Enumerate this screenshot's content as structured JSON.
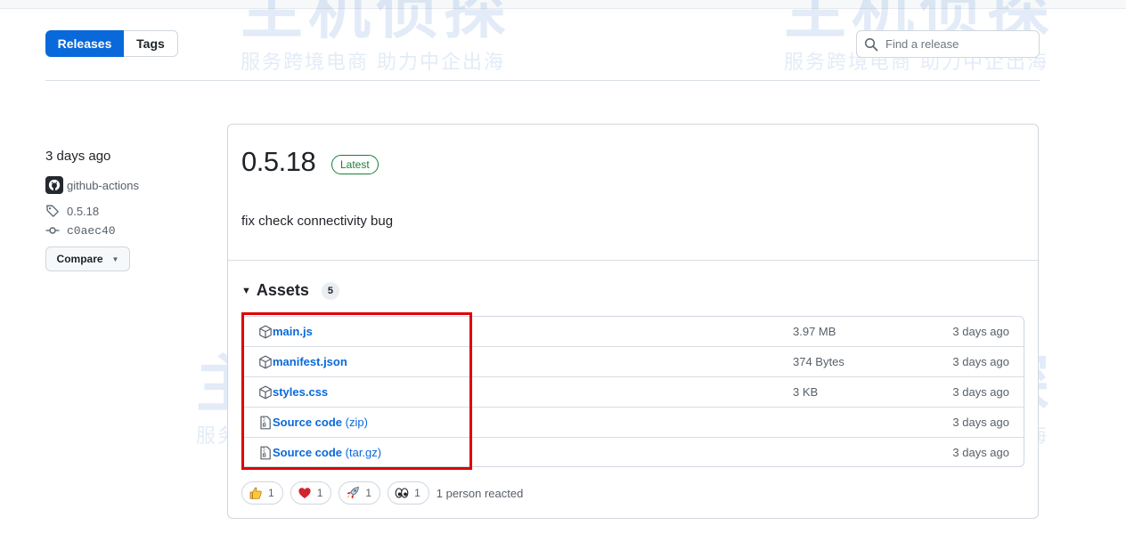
{
  "tabs": {
    "releases_label": "Releases",
    "tags_label": "Tags"
  },
  "search": {
    "placeholder": "Find a release"
  },
  "meta": {
    "date": "3 days ago",
    "author": "github-actions",
    "tag": "0.5.18",
    "commit": "c0aec40",
    "compare_label": "Compare"
  },
  "release": {
    "version": "0.5.18",
    "badge": "Latest",
    "notes": "fix check connectivity bug"
  },
  "assets": {
    "title": "Assets",
    "count": "5",
    "items": [
      {
        "name": "main.js",
        "ext": "",
        "size": "3.97 MB",
        "date": "3 days ago",
        "icon": "package-icon"
      },
      {
        "name": "manifest.json",
        "ext": "",
        "size": "374 Bytes",
        "date": "3 days ago",
        "icon": "package-icon"
      },
      {
        "name": "styles.css",
        "ext": "",
        "size": "3 KB",
        "date": "3 days ago",
        "icon": "package-icon"
      },
      {
        "name": "Source code",
        "ext": " (zip)",
        "size": "",
        "date": "3 days ago",
        "icon": "file-zip-icon"
      },
      {
        "name": "Source code",
        "ext": " (tar.gz)",
        "size": "",
        "date": "3 days ago",
        "icon": "file-zip-icon"
      }
    ]
  },
  "reactions": {
    "items": [
      {
        "emoji": "thumbs-up-icon",
        "count": "1"
      },
      {
        "emoji": "heart-icon",
        "count": "1"
      },
      {
        "emoji": "rocket-icon",
        "count": "1"
      },
      {
        "emoji": "eyes-icon",
        "count": "1"
      }
    ],
    "summary": "1 person reacted"
  },
  "watermark": {
    "brand": "主机侦探",
    "slogan": "服务跨境电商 助力中企出海"
  },
  "colors": {
    "accent": "#0969da",
    "latest": "#1a7f37",
    "highlight": "#e00000"
  }
}
